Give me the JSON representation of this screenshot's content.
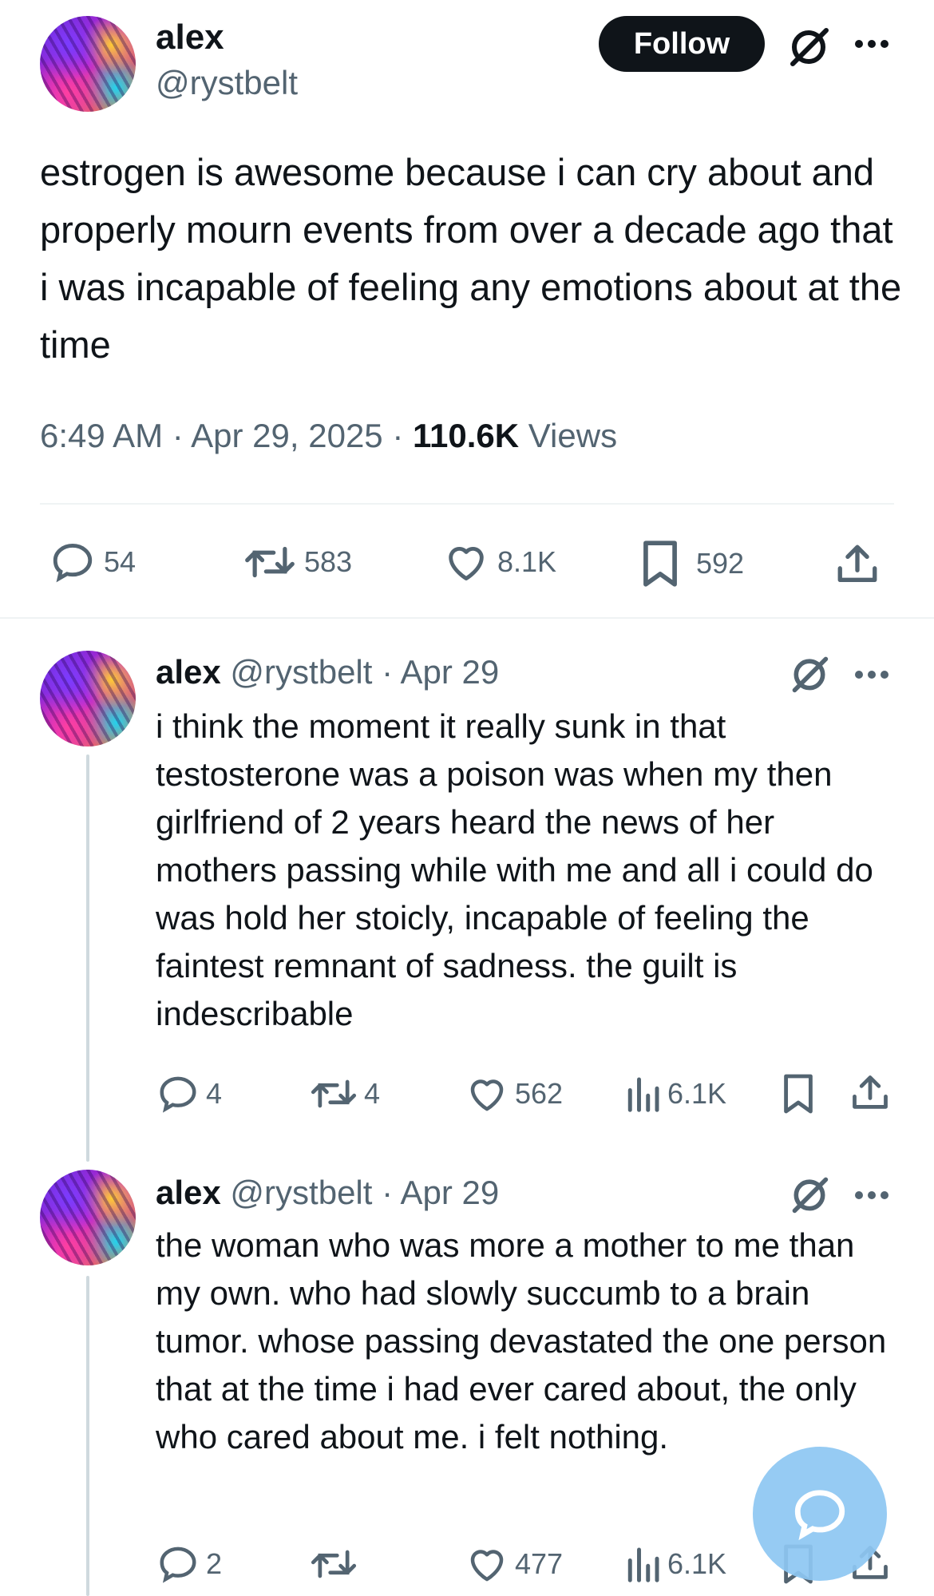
{
  "main": {
    "author_name": "alex",
    "handle": "@rystbelt",
    "follow_label": "Follow",
    "text": "estrogen is awesome because i can cry about and properly mourn events from over a decade ago that i was incapable of feeling any emotions about at the time",
    "time": "6:49 AM",
    "date": "Apr 29, 2025",
    "views_count": "110.6K",
    "views_label": "Views",
    "replies": "54",
    "reposts": "583",
    "likes": "8.1K",
    "bookmarks": "592"
  },
  "replies": [
    {
      "author_name": "alex",
      "handle": "@rystbelt",
      "date": "Apr 29",
      "text": "i think the moment it really sunk in that testosterone was a poison was when my then girlfriend of 2 years heard the news of her mothers passing while with me and all i could do was hold her stoicly, incapable of feeling the faintest remnant of sadness. the guilt is indescribable",
      "replies": "4",
      "reposts": "4",
      "likes": "562",
      "views": "6.1K"
    },
    {
      "author_name": "alex",
      "handle": "@rystbelt",
      "date": "Apr 29",
      "text": "the woman who was more a mother to me than my own. who had slowly succumb to a brain tumor. whose passing devastated the one person that at the time i had ever cared about, the only who cared about me. i felt nothing.",
      "replies": "2",
      "reposts": "",
      "likes": "477",
      "views": "6.1K"
    }
  ],
  "separator": "·",
  "colors": {
    "text": "#0f1419",
    "muted": "#536471",
    "divider": "#eff3f4",
    "fab": "#8ec7f3"
  }
}
